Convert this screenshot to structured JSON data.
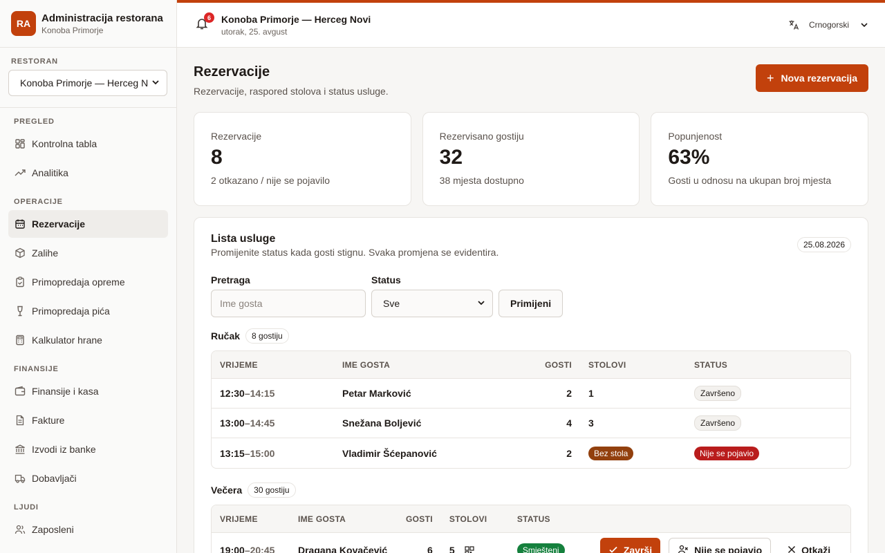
{
  "brand": {
    "initials": "RA",
    "title": "Administracija restorana",
    "subtitle": "Konoba Primorje"
  },
  "sidebar": {
    "restaurant_label": "RESTORAN",
    "restaurant_value": "Konoba Primorje — Herceg Novi",
    "sections": [
      {
        "label": "PREGLED",
        "items": [
          {
            "label": "Kontrolna tabla",
            "icon": "dashboard-icon"
          },
          {
            "label": "Analitika",
            "icon": "trend-icon"
          }
        ]
      },
      {
        "label": "OPERACIJE",
        "items": [
          {
            "label": "Rezervacije",
            "icon": "calendar-icon",
            "active": true
          },
          {
            "label": "Zalihe",
            "icon": "box-icon"
          },
          {
            "label": "Primopredaja opreme",
            "icon": "clipboard-icon"
          },
          {
            "label": "Primopredaja pića",
            "icon": "wine-icon"
          },
          {
            "label": "Kalkulator hrane",
            "icon": "calculator-icon"
          }
        ]
      },
      {
        "label": "FINANSIJE",
        "items": [
          {
            "label": "Finansije i kasa",
            "icon": "wallet-icon"
          },
          {
            "label": "Fakture",
            "icon": "file-icon"
          },
          {
            "label": "Izvodi iz banke",
            "icon": "bank-icon"
          },
          {
            "label": "Dobavljači",
            "icon": "truck-icon"
          }
        ]
      },
      {
        "label": "LJUDI",
        "items": [
          {
            "label": "Zaposleni",
            "icon": "users-icon"
          }
        ]
      }
    ]
  },
  "topbar": {
    "notifications": "6",
    "title": "Konoba Primorje — Herceg Novi",
    "date": "utorak, 25. avgust",
    "language": "Crnogorski"
  },
  "page": {
    "title": "Rezervacije",
    "subtitle": "Rezervacije, raspored stolova i status usluge.",
    "new_button": "Nova rezervacija"
  },
  "stats": [
    {
      "label": "Rezervacije",
      "value": "8",
      "note": "2 otkazano / nije se pojavilo"
    },
    {
      "label": "Rezervisano gostiju",
      "value": "32",
      "note": "38 mjesta dostupno"
    },
    {
      "label": "Popunjenost",
      "value": "63%",
      "note": "Gosti u odnosu na ukupan broj mjesta"
    }
  ],
  "service": {
    "title": "Lista usluge",
    "subtitle": "Promijenite status kada gosti stignu. Svaka promjena se evidentira.",
    "date": "25.08.2026",
    "search_label": "Pretraga",
    "search_placeholder": "Ime gosta",
    "status_label": "Status",
    "status_value": "Sve",
    "apply_button": "Primijeni",
    "columns": {
      "time": "VRIJEME",
      "guest": "IME GOSTA",
      "guests": "GOSTI",
      "tables": "STOLOVI",
      "status": "STATUS"
    },
    "lunch": {
      "title": "Ručak",
      "count": "8 gostiju",
      "rows": [
        {
          "start": "12:30",
          "end": "–14:15",
          "name": "Petar Marković",
          "guests": "2",
          "table": "1",
          "status": "Završeno"
        },
        {
          "start": "13:00",
          "end": "–14:45",
          "name": "Snežana Boljević",
          "guests": "4",
          "table": "3",
          "status": "Završeno"
        },
        {
          "start": "13:15",
          "end": "–15:00",
          "name": "Vladimir Šćepanović",
          "guests": "2",
          "table": "Bez stola",
          "status": "Nije se pojavio"
        }
      ]
    },
    "dinner": {
      "title": "Večera",
      "count": "30 gostiju",
      "rows": [
        {
          "start": "19:00",
          "end": "–20:45",
          "name": "Dragana Kovačević",
          "guests": "6",
          "table": "5",
          "status": "Smješteni",
          "actions": {
            "complete": "Završi",
            "no_show": "Nije se pojavio",
            "cancel": "Otkaži"
          }
        }
      ]
    }
  },
  "colors": {
    "accent": "#c2410c",
    "no_show": "#b91c1c",
    "no_table": "#92400e",
    "seated": "#15803d"
  }
}
